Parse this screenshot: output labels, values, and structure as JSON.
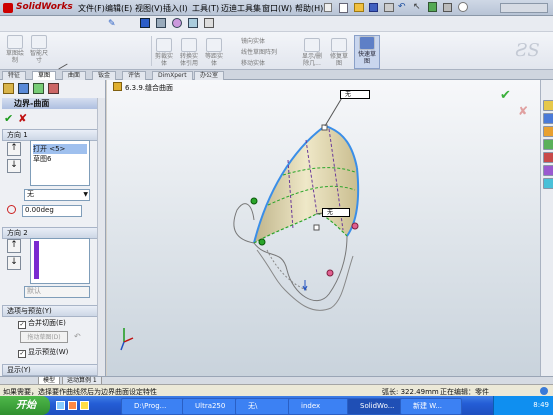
{
  "app": {
    "name": "SolidWorks"
  },
  "menu": [
    "文件(F)",
    "编辑(E)",
    "视图(V)",
    "插入(I)",
    "工具(T)",
    "迈迪工具集",
    "窗口(W)",
    "帮助(H)"
  ],
  "ribbon": {
    "items": [
      {
        "label": "草图绘\n制",
        "name": "sketch-button"
      },
      {
        "label": "智能尺\n寸",
        "name": "smart-dimension-button"
      },
      {
        "label": "剪裁实\n体",
        "name": "trim-button"
      },
      {
        "label": "转换实\n体引用",
        "name": "convert-button"
      },
      {
        "label": "等距实\n体",
        "name": "offset-button"
      },
      {
        "label": "显示/删\n除几...",
        "name": "display-delete-button"
      },
      {
        "label": "修复草\n图",
        "name": "repair-sketch-button"
      },
      {
        "label": "快速草\n图",
        "name": "rapid-sketch-button"
      }
    ],
    "mirror_items": [
      "镜向实体",
      "线性草图阵列",
      "移动实体"
    ]
  },
  "tabs": [
    "特征",
    "草图",
    "曲面",
    "钣金",
    "评估",
    "DimXpert",
    "办公室"
  ],
  "active_tab": "草图",
  "breadcrumb": "6.3.9.缝合曲面",
  "property_manager": {
    "title": "边界-曲面",
    "ok": "✔",
    "cancel": "✘",
    "direction1": {
      "heading": "方向 1",
      "list": [
        "打开 <5>",
        "草图6"
      ],
      "tangency": "无",
      "angle": "0.00deg"
    },
    "direction2": {
      "heading": "方向 2",
      "default": "默认"
    },
    "options": {
      "heading": "选项与预览(Y)",
      "merge_faces": "合并切面(E)",
      "drag_sketch": "拖动草图(D)",
      "show_preview": "显示预览(W)"
    },
    "display": "显示(Y)"
  },
  "bottom_tabs": [
    "模型",
    "运动算例 1"
  ],
  "callouts": [
    "无",
    "无"
  ],
  "status": {
    "message": "如果需要，选择要作曲线然后为边界曲面设定特性",
    "length": "弧长: 322.49mm",
    "editing": "正在编辑：零件"
  },
  "taskbar": {
    "start": "开始",
    "buttons": [
      "D:\\Prog...",
      "Ultra250",
      "无\\",
      "index",
      "SolidWo...",
      "新建 W..."
    ],
    "clock": "8:49"
  },
  "colors": {
    "accent": "#1e4fbf",
    "surface": "#dcd4a8",
    "edge": "#3a8ee8"
  }
}
